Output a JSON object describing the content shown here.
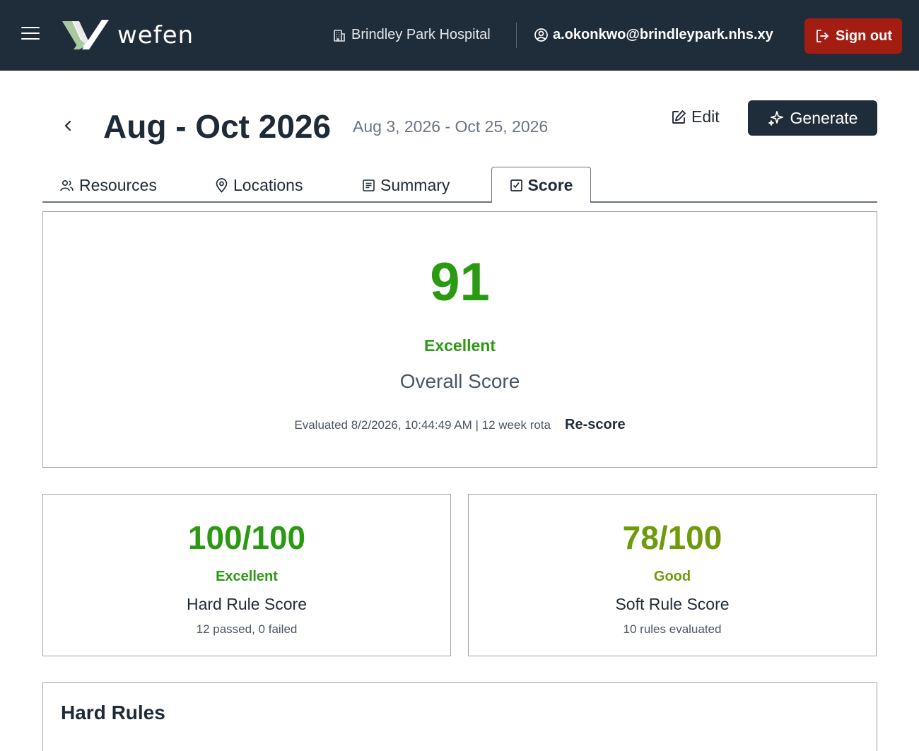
{
  "header": {
    "logo_text": "wefen",
    "hospital": "Brindley Park Hospital",
    "user_email": "a.okonkwo@brindleypark.nhs.xy",
    "sign_out_label": "Sign out",
    "icons": [
      "menu-icon",
      "building-icon",
      "user-circle-icon",
      "sign-out-icon"
    ]
  },
  "page": {
    "title": "Aug - Oct 2026",
    "date_range": "Aug 3, 2026 - Oct 25, 2026",
    "edit_label": "Edit",
    "generate_label": "Generate"
  },
  "tabs": [
    {
      "label": "Resources",
      "icon": "users-icon",
      "active": false
    },
    {
      "label": "Locations",
      "icon": "map-pin-icon",
      "active": false
    },
    {
      "label": "Summary",
      "icon": "document-icon",
      "active": false
    },
    {
      "label": "Score",
      "icon": "score-icon",
      "active": true
    }
  ],
  "overall": {
    "score": "91",
    "rating": "Excellent",
    "label": "Overall Score",
    "evaluated": "Evaluated 8/2/2026, 10:44:49 AM | 12 week rota",
    "rescore_label": "Re-score"
  },
  "hard_rule": {
    "score": "100/100",
    "rating": "Excellent",
    "label": "Hard Rule Score",
    "detail": "12 passed, 0 failed"
  },
  "soft_rule": {
    "score": "78/100",
    "rating": "Good",
    "label": "Soft Rule Score",
    "detail": "10 rules evaluated"
  },
  "hard_rules_section": {
    "title": "Hard Rules"
  },
  "colors": {
    "header_bg": "#1f2d3a",
    "sign_out_bg": "#a31d12",
    "excellent": "#2a9a12",
    "good": "#6e9a0c",
    "logo_green": "#a8c9a0"
  }
}
